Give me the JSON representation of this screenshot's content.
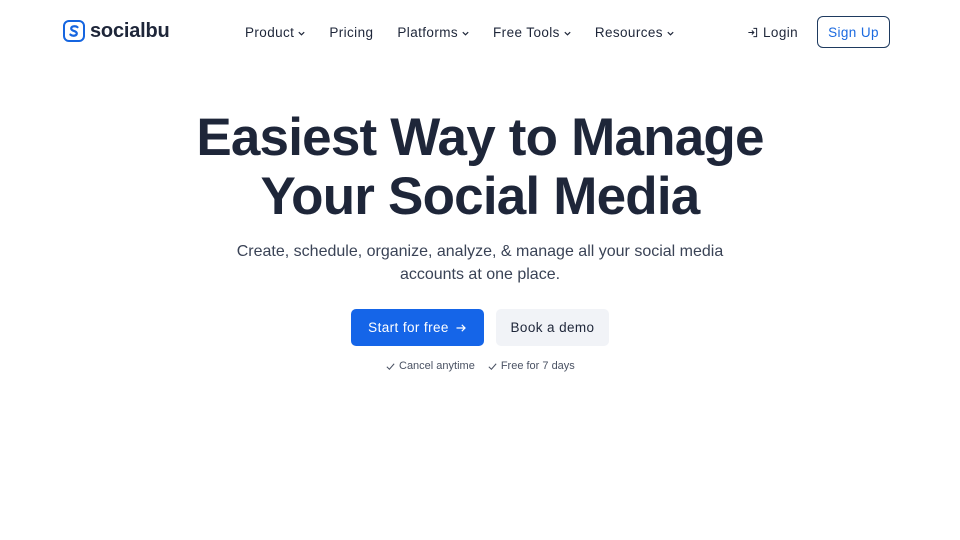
{
  "brand": {
    "name": "socialbu",
    "color": "#1565e0"
  },
  "nav": {
    "items": [
      {
        "label": "Product",
        "dropdown": true
      },
      {
        "label": "Pricing",
        "dropdown": false
      },
      {
        "label": "Platforms",
        "dropdown": true
      },
      {
        "label": "Free Tools",
        "dropdown": true
      },
      {
        "label": "Resources",
        "dropdown": true
      }
    ],
    "login_label": "Login",
    "signup_label": "Sign Up"
  },
  "hero": {
    "title_line1": "Easiest Way to Manage",
    "title_line2": "Your Social Media",
    "subtitle": "Create, schedule, organize, analyze, & manage all your social media accounts at one place.",
    "primary_cta": "Start for free",
    "secondary_cta": "Book a demo",
    "perks": [
      "Cancel anytime",
      "Free for 7 days"
    ]
  },
  "colors": {
    "primary": "#1565e8",
    "text": "#1e2639",
    "secondary_button_bg": "#f1f3f7",
    "signup_border": "#1e3a5f"
  }
}
